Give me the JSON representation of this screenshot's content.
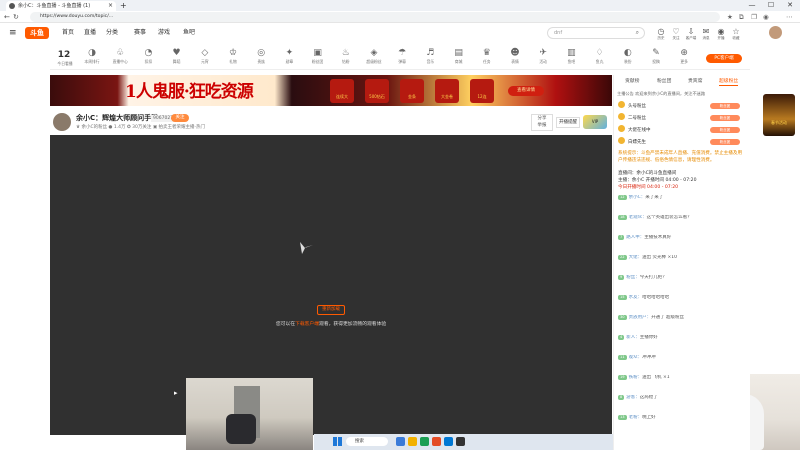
{
  "browser": {
    "tab_title": "余小C：斗鱼直播 - 斗鱼直播 (1)",
    "url": "https://www.douyu.com/topic/...",
    "new_tab": "+",
    "win_min": "—",
    "win_max": "☐",
    "win_close": "✕"
  },
  "site": {
    "logo": "斗鱼",
    "nav": [
      "首页",
      "直播",
      "分类",
      "赛事",
      "游戏",
      "鱼吧"
    ],
    "search_placeholder": "dnf",
    "header_icons": [
      {
        "icon": "history-icon",
        "glyph": "◷",
        "label": "历史"
      },
      {
        "icon": "follow-icon",
        "glyph": "♡",
        "label": "关注"
      },
      {
        "icon": "download-icon",
        "glyph": "⇩",
        "label": "客户端"
      },
      {
        "icon": "message-icon",
        "glyph": "✉",
        "label": "消息"
      },
      {
        "icon": "broadcast-icon",
        "glyph": "◉",
        "label": "开播"
      },
      {
        "icon": "star-icon",
        "glyph": "☆",
        "label": "收藏"
      }
    ],
    "pc_button": "PC客户端"
  },
  "categories": {
    "count": "12",
    "count_label": "今日看播",
    "items": [
      {
        "glyph": "◑",
        "label": "本周排行"
      },
      {
        "glyph": "♧",
        "label": "直播中心"
      },
      {
        "glyph": "◔",
        "label": "扣扣"
      },
      {
        "glyph": "♥",
        "label": "舞蹈"
      },
      {
        "glyph": "◇",
        "label": "元宵"
      },
      {
        "glyph": "♔",
        "label": "礼物"
      },
      {
        "glyph": "◎",
        "label": "贵族"
      },
      {
        "glyph": "✦",
        "label": "勋章"
      },
      {
        "glyph": "▣",
        "label": "粉丝团"
      },
      {
        "glyph": "♨",
        "label": "钻粉"
      },
      {
        "glyph": "◈",
        "label": "超级粉丝"
      },
      {
        "glyph": "☂",
        "label": "弹幕"
      },
      {
        "glyph": "♬",
        "label": "音乐"
      },
      {
        "glyph": "▤",
        "label": "商城"
      },
      {
        "glyph": "♛",
        "label": "任务"
      },
      {
        "glyph": "☻",
        "label": "表情"
      },
      {
        "glyph": "✈",
        "label": "活动"
      },
      {
        "glyph": "▥",
        "label": "鱼吧"
      },
      {
        "glyph": "♢",
        "label": "鱼丸"
      },
      {
        "glyph": "◐",
        "label": "装扮"
      },
      {
        "glyph": "✎",
        "label": "投稿"
      },
      {
        "glyph": "⊕",
        "label": "更多"
      }
    ]
  },
  "banner": {
    "title": "1人鬼服·狂吃资源",
    "gifts": [
      "连续大",
      "500钻石",
      "金条",
      "大金卷",
      "12连"
    ],
    "button": "查看详情"
  },
  "room": {
    "title": "余小C：辉煌大师顾问手游",
    "room_id": "9067027",
    "follow": "关注",
    "subtitle": "♛ 余小C的粉丝  ● 1.4万  ✪ 30万关注  ▣ 拍卖王者荣耀主播·热门",
    "share": "分享",
    "report": "举报",
    "subscribe": "开播提醒",
    "vip_label": "VIP"
  },
  "player": {
    "button": "重新加载",
    "tip_prefix": "您可以在",
    "tip_highlight": "下载客户端",
    "tip_suffix": "观看，获得更加流畅的观看体验"
  },
  "taskbar": {
    "search": "搜索",
    "apps": [
      "#3b7bd8",
      "#f2b100",
      "#1b9e53",
      "#e34c26",
      "#0078d4",
      "#333333"
    ]
  },
  "panel": {
    "tabs": [
      "贡献榜",
      "粉丝团",
      "贵宾席",
      "超级粉丝"
    ],
    "notice": "主播公告  欢迎来到余小C的直播间，关注不迷路",
    "ranks": [
      {
        "name": "头号粉丝",
        "tag": "粉丝团"
      },
      {
        "name": "二号粉丝",
        "tag": "粉丝团"
      },
      {
        "name": "大佬在线中",
        "tag": "粉丝团"
      },
      {
        "name": "白嫖先生",
        "tag": "粉丝团"
      }
    ],
    "system_notice": "系统提示：斗鱼严禁未成年人直播、充值消费。禁止主播及用户传播违法违规、低俗色情信息，请理性消费。",
    "welcome_lines": [
      "直播间：余小C的斗鱼直播间",
      "主播：余小C  开播时间 04:00 - 07:20",
      "今日开播时间 04:00 - 07:20"
    ],
    "messages": [
      {
        "lv": "12",
        "name": "余小C",
        "text": "来了来了"
      },
      {
        "lv": "18",
        "name": "老观众",
        "text": "这个英雄出装怎么看？"
      },
      {
        "lv": "7",
        "name": "路人甲",
        "text": "主播技术真好"
      },
      {
        "lv": "22",
        "name": "大佬",
        "text": "送出 荧光棒 ×10"
      },
      {
        "lv": "9",
        "name": "粉丝",
        "text": "今天打几把？"
      },
      {
        "lv": "15",
        "name": "水友",
        "text": "哈哈哈哈哈哈"
      },
      {
        "lv": "30",
        "name": "贵族用户",
        "text": "开通了 超级粉丝"
      },
      {
        "lv": "4",
        "name": "新人",
        "text": "主播你好"
      },
      {
        "lv": "11",
        "name": "观众",
        "text": "冲冲冲"
      },
      {
        "lv": "19",
        "name": "铁粉",
        "text": "送出 飞机 ×1"
      },
      {
        "lv": "8",
        "name": "游客",
        "text": "这局稳了"
      },
      {
        "lv": "13",
        "name": "老粉",
        "text": "晚上好"
      }
    ]
  },
  "right_ad": {
    "label": "春节活动"
  },
  "colors": {
    "accent": "#ff5a00",
    "player_bg": "#303030"
  }
}
